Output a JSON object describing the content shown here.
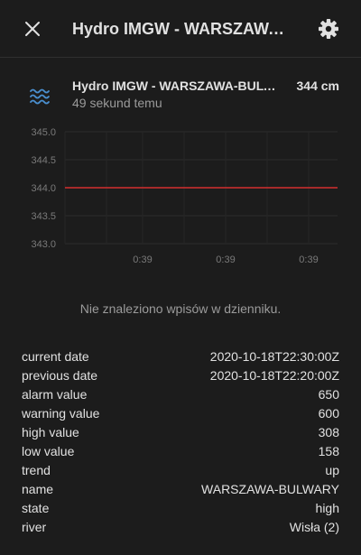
{
  "header": {
    "title": "Hydro IMGW - WARSZAWA-BULWARY"
  },
  "entity": {
    "name": "Hydro IMGW - WARSZAWA-BULWARY",
    "value": "344 cm",
    "last_changed": "49 sekund temu",
    "icon": "waves-icon"
  },
  "colors": {
    "accent_icon": "#4a8fcf",
    "series_line": "#d32f2f"
  },
  "chart_data": {
    "type": "line",
    "x_tick_labels": [
      "0:39",
      "0:39",
      "0:39"
    ],
    "y_tick_labels": [
      "345.0",
      "344.5",
      "344.0",
      "343.5",
      "343.0"
    ],
    "ylim": [
      343.0,
      345.0
    ],
    "series": [
      {
        "values": [
          344.0,
          344.0
        ]
      }
    ],
    "grid": true
  },
  "logbook": {
    "empty_text": "Nie znaleziono wpisów w dzienniku."
  },
  "attributes": [
    {
      "label": "current date",
      "value": "2020-10-18T22:30:00Z"
    },
    {
      "label": "previous date",
      "value": "2020-10-18T22:20:00Z"
    },
    {
      "label": "alarm value",
      "value": "650"
    },
    {
      "label": "warning value",
      "value": "600"
    },
    {
      "label": "high value",
      "value": "308"
    },
    {
      "label": "low value",
      "value": "158"
    },
    {
      "label": "trend",
      "value": "up"
    },
    {
      "label": "name",
      "value": "WARSZAWA-BULWARY"
    },
    {
      "label": "state",
      "value": "high"
    },
    {
      "label": "river",
      "value": "Wisła (2)"
    }
  ]
}
